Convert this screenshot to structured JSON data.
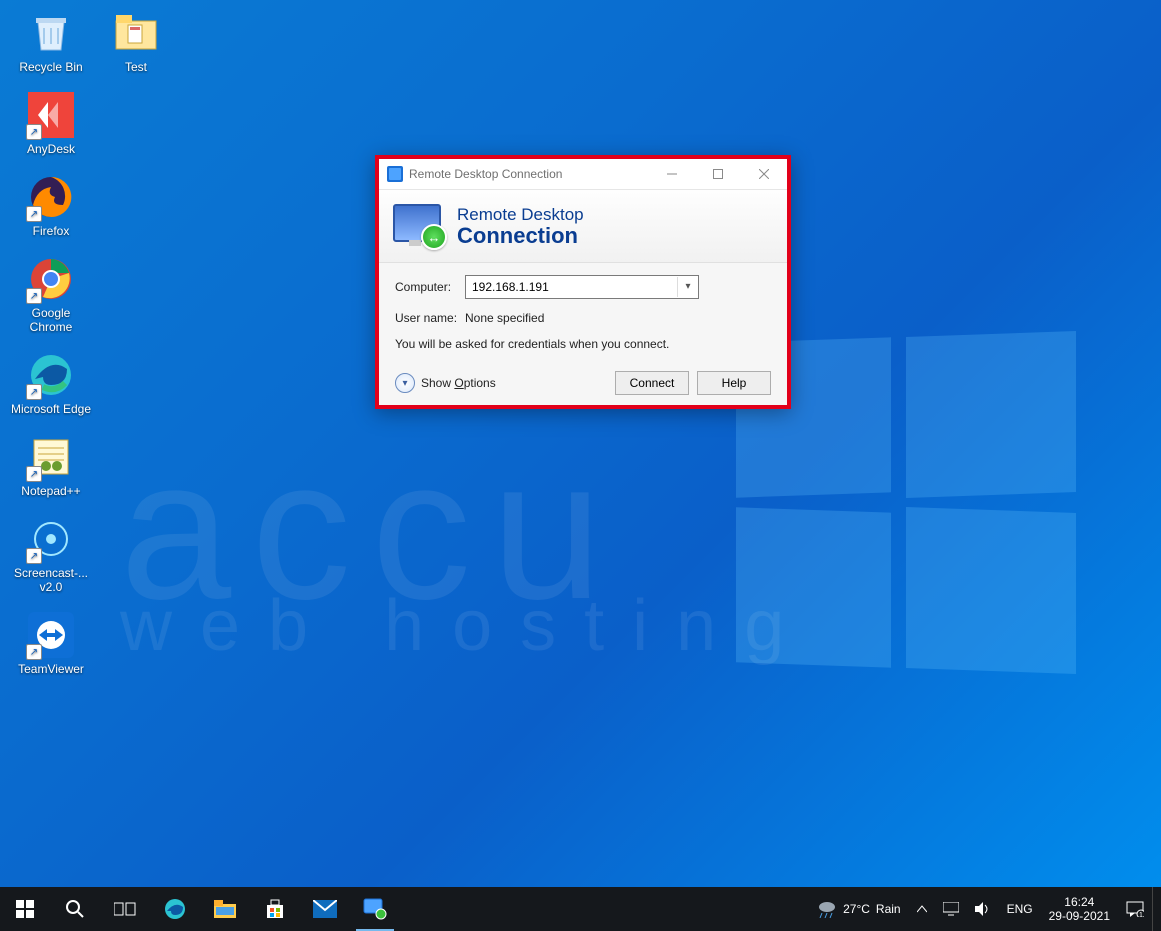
{
  "desktop_icons_col1": [
    {
      "label": "Recycle Bin",
      "icon": "recycle-bin",
      "shortcut": false,
      "bg": "#ffffff",
      "fg": "#2e8fdd"
    },
    {
      "label": "AnyDesk",
      "icon": "anydesk",
      "shortcut": true,
      "bg": "#ef443b",
      "fg": "#ffffff"
    },
    {
      "label": "Firefox",
      "icon": "firefox",
      "shortcut": true,
      "bg": "#ff8a00",
      "fg": "#331e54"
    },
    {
      "label": "Google Chrome",
      "icon": "chrome",
      "shortcut": true,
      "bg": "#ffffff",
      "fg": "#4285F4"
    },
    {
      "label": "Microsoft Edge",
      "icon": "edge",
      "shortcut": true,
      "bg": "#0c59a4",
      "fg": "#33c481"
    },
    {
      "label": "Notepad++",
      "icon": "notepadpp",
      "shortcut": true,
      "bg": "#fff9d6",
      "fg": "#6b9d2f"
    },
    {
      "label": "Screencast-... v2.0",
      "icon": "screencast",
      "shortcut": true,
      "bg": "transparent",
      "fg": "#a0e7ff"
    },
    {
      "label": "TeamViewer",
      "icon": "teamviewer",
      "shortcut": true,
      "bg": "#0e6fd6",
      "fg": "#ffffff"
    }
  ],
  "desktop_icons_col2": [
    {
      "label": "Test",
      "icon": "folder",
      "shortcut": false,
      "bg": "#ffe79e",
      "fg": "#caa53a"
    }
  ],
  "rdc": {
    "title": "Remote Desktop Connection",
    "banner1": "Remote Desktop",
    "banner2": "Connection",
    "computer_label": "Computer:",
    "computer_value": "192.168.1.191",
    "username_label": "User name:",
    "username_value": "None specified",
    "hint": "You will be asked for credentials when you connect.",
    "show_options": "Show Options",
    "connect": "Connect",
    "help": "Help"
  },
  "taskbar": {
    "weather_temp": "27°C",
    "weather_desc": "Rain",
    "lang": "ENG",
    "time": "16:24",
    "date": "29-09-2021"
  },
  "watermark": {
    "l1": "accu",
    "l2": "web  hosting"
  }
}
